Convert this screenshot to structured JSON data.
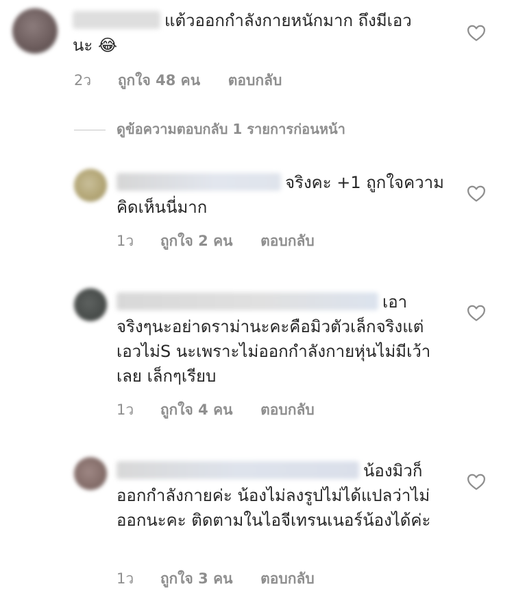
{
  "comments": [
    {
      "text": "แต้วออกกำลังกายหนักมาก ถึงมีเอวนะ",
      "emoji": "😂",
      "time": "2ว",
      "likes": "ถูกใจ 48 คน",
      "reply": "ตอบกลับ"
    },
    {
      "text": "จริงคะ +1 ถูกใจความคิดเห็นนี่มาก",
      "time": "1ว",
      "likes": "ถูกใจ 2 คน",
      "reply": "ตอบกลับ"
    },
    {
      "text": "เอาจริงๆนะอย่าดราม่านะคะคือมิวตัวเล็กจริงแต่เอวไม่S นะเพราะไม่ออกกำลังกายหุ่นไม่มีเว้าเลย เล็กๆเรียบ",
      "time": "1ว",
      "likes": "ถูกใจ 4 คน",
      "reply": "ตอบกลับ"
    },
    {
      "text": "น้องมิวก็ออกกำลังกายค่ะ น้องไม่ลงรูปไม่ได้แปลว่าไม่ออกนะคะ ติดตามในไอจีเทรนเนอร์น้องได้ค่ะ",
      "time": "1ว",
      "likes": "ถูกใจ 3 คน",
      "reply": "ตอบกลับ"
    }
  ],
  "view_replies": "ดูข้อความตอบกลับ 1 รายการก่อนหน้า",
  "icons": {
    "like": "heart-outline-icon"
  },
  "colors": {
    "text": "#262626",
    "meta": "#8e8e8e",
    "heart": "#8e8e8e"
  }
}
